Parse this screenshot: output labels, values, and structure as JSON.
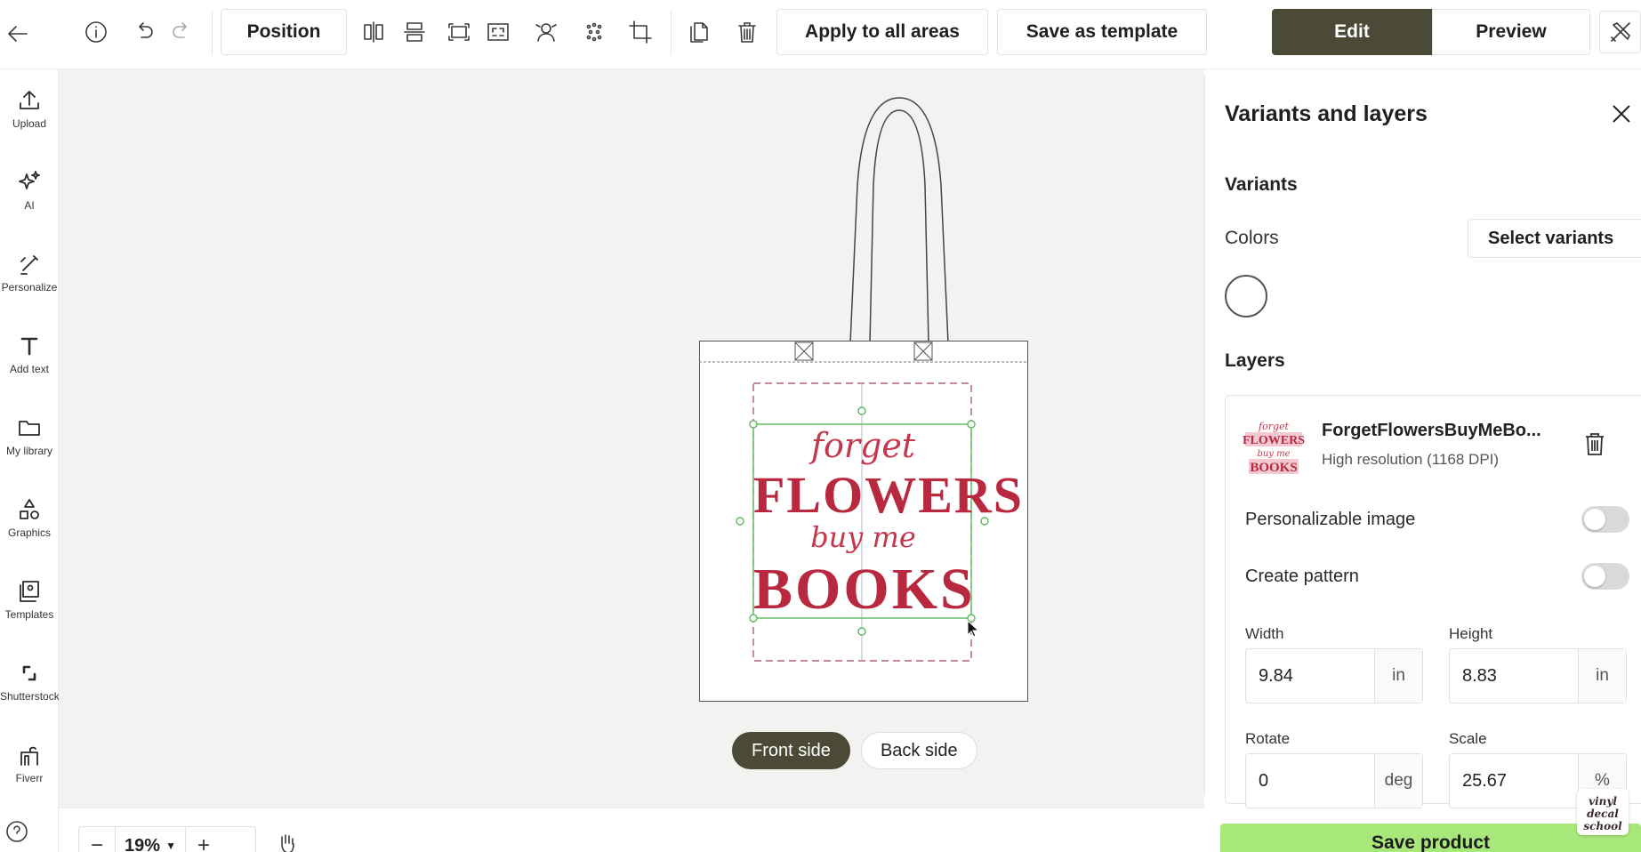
{
  "toolbar": {
    "position_label": "Position",
    "apply_all_label": "Apply to all areas",
    "save_template_label": "Save as template",
    "edit_label": "Edit",
    "preview_label": "Preview"
  },
  "sidebar": {
    "items": [
      {
        "label": "Upload",
        "icon": "upload-icon"
      },
      {
        "label": "AI",
        "icon": "sparkle-icon"
      },
      {
        "label": "Personalize",
        "icon": "personalize-icon"
      },
      {
        "label": "Add text",
        "icon": "text-icon"
      },
      {
        "label": "My library",
        "icon": "folder-icon"
      },
      {
        "label": "Graphics",
        "icon": "shapes-icon"
      },
      {
        "label": "Templates",
        "icon": "templates-icon"
      },
      {
        "label": "Shutterstock",
        "icon": "shutterstock-icon"
      },
      {
        "label": "Fiverr",
        "icon": "fiverr-icon"
      }
    ]
  },
  "canvas": {
    "design_text": {
      "line1": "forget",
      "line2": "FLOWERS",
      "line3": "buy me",
      "line4": "BOOKS"
    },
    "side_tabs": [
      "Front side",
      "Back side"
    ],
    "active_side": "Front side"
  },
  "panel": {
    "title": "Variants and layers",
    "variants_heading": "Variants",
    "colors_label": "Colors",
    "select_variants_label": "Select variants",
    "layers_heading": "Layers",
    "layer": {
      "name": "ForgetFlowersBuyMeBo...",
      "resolution": "High resolution (1168 DPI)",
      "personalizable_label": "Personalizable image",
      "personalizable_on": false,
      "pattern_label": "Create pattern",
      "pattern_on": false,
      "width_label": "Width",
      "width_value": "9.84",
      "width_unit": "in",
      "height_label": "Height",
      "height_value": "8.83",
      "height_unit": "in",
      "rotate_label": "Rotate",
      "rotate_value": "0",
      "rotate_unit": "deg",
      "scale_label": "Scale",
      "scale_value": "25.67",
      "scale_unit": "%"
    }
  },
  "bottom": {
    "zoom_value": "19%",
    "save_product_label": "Save product"
  },
  "colors": {
    "edit_bg": "#4a4a36",
    "save_green": "#a8e87a",
    "design_red": "#b8283e",
    "design_pink": "#e9899a"
  }
}
